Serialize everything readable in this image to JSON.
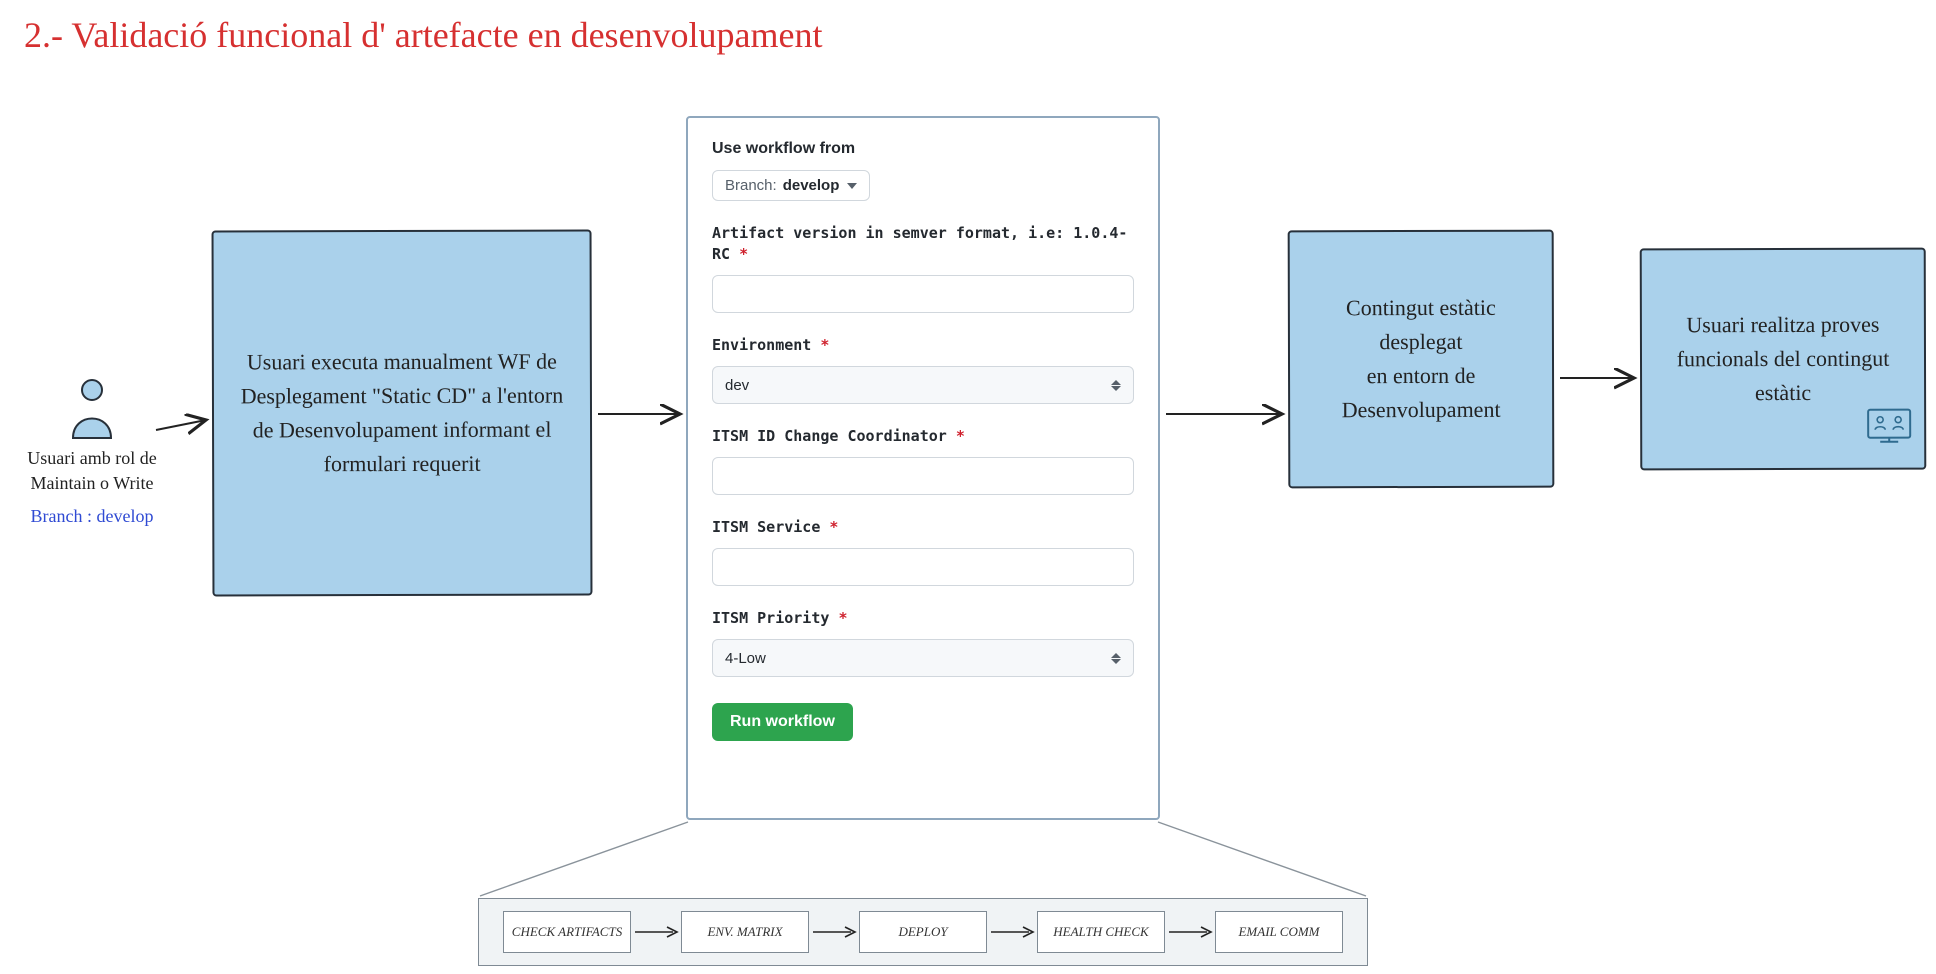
{
  "title": "2.- Validació funcional d' artefacte en desenvolupament",
  "actor": {
    "caption_l1": "Usuari amb rol de",
    "caption_l2": "Maintain o Write",
    "branch": "Branch : develop"
  },
  "box1": "Usuari executa manualment WF de Desplegament \"Static CD\" a l'entorn de Desenvolupament informant el formulari requerit",
  "box2_l1": "Contingut estàtic",
  "box2_l2": "desplegat",
  "box2_l3": "en entorn de",
  "box2_l4": "Desenvolupament",
  "box3_l1": "Usuari realitza proves",
  "box3_l2": "funcionals del contingut",
  "box3_l3": "estàtic",
  "form": {
    "use_from": "Use workflow from",
    "branch_label": "Branch:",
    "branch_value": "develop",
    "f1_label": "Artifact version in semver format, i.e: 1.0.4-RC",
    "f2_label": "Environment",
    "f2_value": "dev",
    "f3_label": "ITSM ID Change Coordinator",
    "f4_label": "ITSM Service",
    "f5_label": "ITSM Priority",
    "f5_value": "4-Low",
    "run": "Run workflow"
  },
  "pipeline": {
    "s1": "CHECK ARTIFACTS",
    "s2": "ENV. MATRIX",
    "s3": "DEPLOY",
    "s4": "HEALTH CHECK",
    "s5": "EMAIL COMM"
  }
}
